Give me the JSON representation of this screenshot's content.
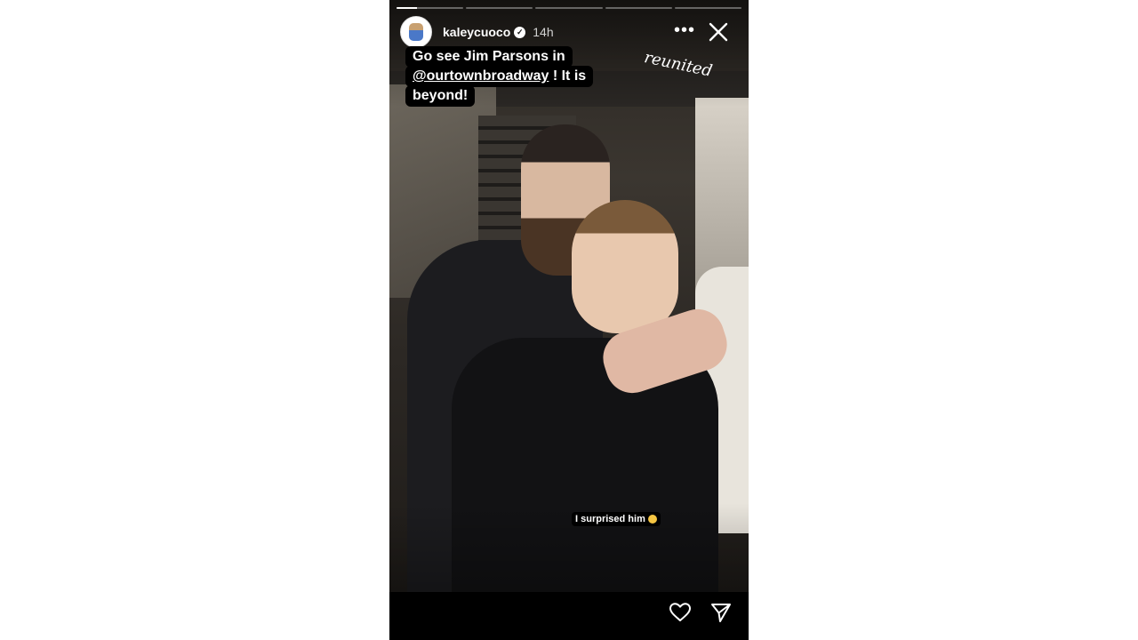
{
  "story": {
    "progress_segments": [
      1,
      0,
      0,
      0,
      0
    ],
    "first_segment_fill": 0.3,
    "user": {
      "username": "kaleycuoco",
      "verified_mark": "✓",
      "time": "14h"
    },
    "menu": "•••",
    "caption": {
      "line1": "Go see Jim Parsons in",
      "mention": "@ourtownbroadway",
      "line2_suffix": " ! It is",
      "line3": "beyond!"
    },
    "handwritten": "reunited",
    "sticker": "I surprised him",
    "icons": {
      "avatar": "dog-avatar-icon",
      "close": "close-icon",
      "heart": "heart-icon",
      "share": "send-icon"
    }
  }
}
